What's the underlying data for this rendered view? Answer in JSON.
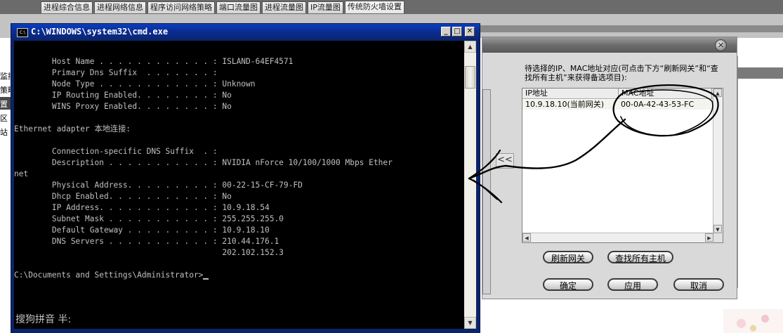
{
  "tabs": [
    "进程综合信息",
    "进程网络信息",
    "程序访问网络策略",
    "端口流量图",
    "进程流量图",
    "IP流量图",
    "传统防火墙设置"
  ],
  "active_tab_index": 6,
  "left_sidebar": [
    "监控",
    "策略",
    "置",
    "区",
    "站"
  ],
  "cmd": {
    "title": "C:\\WINDOWS\\system32\\cmd.exe",
    "lines": [
      "        Host Name . . . . . . . . . . . . : ISLAND-64EF4571",
      "        Primary Dns Suffix  . . . . . . . :",
      "        Node Type . . . . . . . . . . . . : Unknown",
      "        IP Routing Enabled. . . . . . . . : No",
      "        WINS Proxy Enabled. . . . . . . . : No",
      "",
      "Ethernet adapter 本地连接:",
      "",
      "        Connection-specific DNS Suffix  . :",
      "        Description . . . . . . . . . . . : NVIDIA nForce 10/100/1000 Mbps Ether",
      "net",
      "        Physical Address. . . . . . . . . : 00-22-15-CF-79-FD",
      "        Dhcp Enabled. . . . . . . . . . . : No",
      "        IP Address. . . . . . . . . . . . : 10.9.18.54",
      "        Subnet Mask . . . . . . . . . . . : 255.255.255.0",
      "        Default Gateway . . . . . . . . . : 10.9.18.10",
      "        DNS Servers . . . . . . . . . . . : 210.44.176.1",
      "                                            202.102.152.3",
      "",
      "C:\\Documents and Settings\\Administrator>"
    ],
    "ime_status": "搜狗拼音 半:"
  },
  "dialog": {
    "instruction": "待选择的IP、MAC地址对应(可点击下方“刷新网关”和“查找所有主机”来获得备选项目):",
    "columns": [
      "IP地址",
      "MAC地址"
    ],
    "rows": [
      {
        "ip": "10.9.18.10(当前网关)",
        "mac": "00-0A-42-43-53-FC"
      }
    ],
    "buttons": {
      "refresh_gateway": "刷新网关",
      "find_all_hosts": "查找所有主机",
      "ok": "确定",
      "apply": "应用",
      "cancel": "取消"
    },
    "move_left_arrow": "<<"
  },
  "colors": {
    "console_bg": "#000000",
    "console_text": "#c0c0c0",
    "titlebar_blue": "#0a246a"
  }
}
